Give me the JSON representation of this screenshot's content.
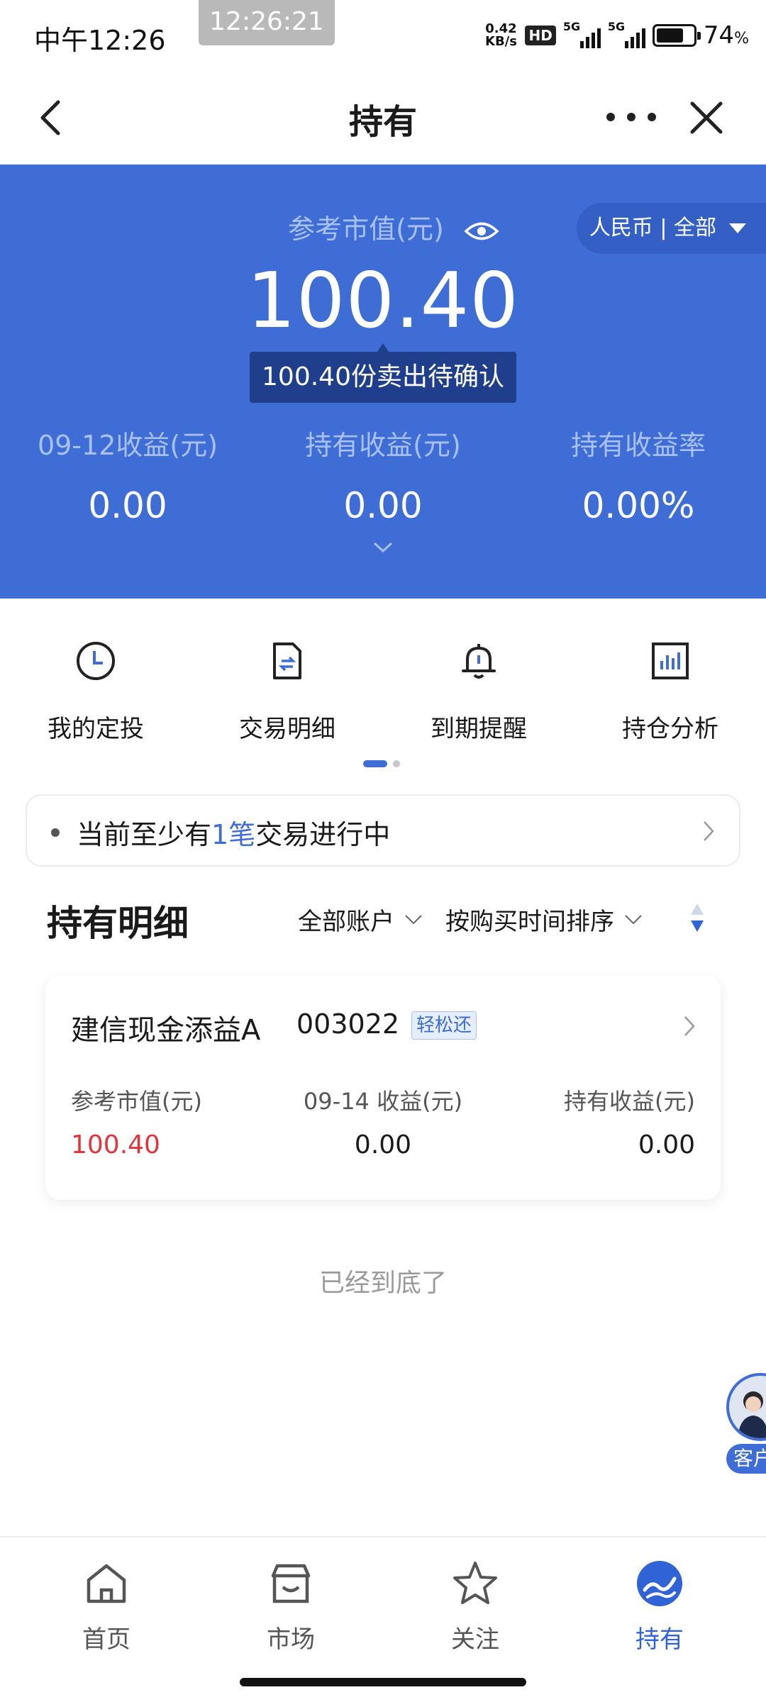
{
  "status_bar": {
    "time": "中午12:26",
    "clock_overlay": "12:26:21",
    "net_speed_value": "0.42",
    "net_speed_unit": "KB/s",
    "hd_badge": "HD",
    "signal_1_label": "5G",
    "signal_2_label": "5G",
    "battery_level": 0.74,
    "battery_percent": "74",
    "battery_unit": "%"
  },
  "nav": {
    "title": "持有"
  },
  "summary": {
    "market_value_label": "参考市值(元)",
    "currency_filter": "人民币 | 全部",
    "market_value": "100.40",
    "pending_tip": "100.40份卖出待确认",
    "stats": [
      {
        "label": "09-12收益(元)",
        "value": "0.00"
      },
      {
        "label": "持有收益(元)",
        "value": "0.00"
      },
      {
        "label": "持有收益率",
        "value": "0.00%"
      }
    ]
  },
  "quick_entries": [
    {
      "label": "我的定投",
      "icon": "clock-icon"
    },
    {
      "label": "交易明细",
      "icon": "transaction-detail-icon"
    },
    {
      "label": "到期提醒",
      "icon": "bell-icon"
    },
    {
      "label": "持仓分析",
      "icon": "bar-chart-icon"
    }
  ],
  "notice": {
    "prefix": "当前至少有",
    "count": "1笔",
    "suffix": "交易进行中"
  },
  "holdings": {
    "title": "持有明细",
    "account_filter": "全部账户",
    "sort_filter": "按购买时间排序",
    "items": [
      {
        "name": "建信现金添益A",
        "code": "003022",
        "tag": "轻松还",
        "col1_label": "参考市值(元)",
        "col1_value": "100.40",
        "col2_label": "09-14 收益(元)",
        "col2_value": "0.00",
        "col3_label": "持有收益(元)",
        "col3_value": "0.00"
      }
    ],
    "end_note": "已经到底了"
  },
  "customer_service": {
    "label": "客户"
  },
  "tab_bar": [
    {
      "label": "首页",
      "icon": "home-icon",
      "active": false
    },
    {
      "label": "市场",
      "icon": "store-icon",
      "active": false
    },
    {
      "label": "关注",
      "icon": "star-icon",
      "active": false
    },
    {
      "label": "持有",
      "icon": "holding-icon",
      "active": true
    }
  ],
  "colors": {
    "primary": "#3e6dd6",
    "loss_red": "#e2343b",
    "tooltip_bg": "#1f3f8c"
  }
}
